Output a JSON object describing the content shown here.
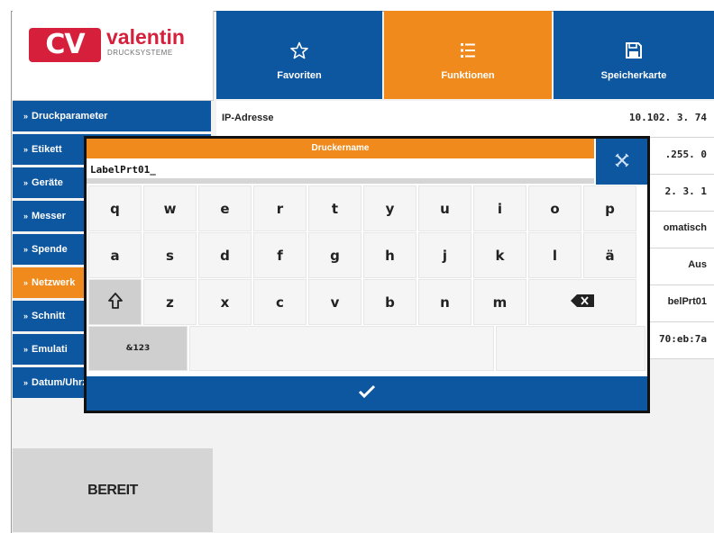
{
  "logo": {
    "mark": "CV",
    "name": "valentin",
    "sub": "DRUCKSYSTEME"
  },
  "tabs": [
    {
      "label": "Favoriten",
      "icon": "star-icon"
    },
    {
      "label": "Funktionen",
      "icon": "list-icon"
    },
    {
      "label": "Speicherkarte",
      "icon": "floppy-icon"
    }
  ],
  "sidebar": {
    "items": [
      {
        "label": "Druckparameter"
      },
      {
        "label": "Etikett"
      },
      {
        "label": "Geräte"
      },
      {
        "label": "Messer"
      },
      {
        "label": "Spende"
      },
      {
        "label": "Netzwerk"
      },
      {
        "label": "Schnitt"
      },
      {
        "label": "Emulati"
      },
      {
        "label": "Datum/Uhrzeit"
      }
    ]
  },
  "status": "BEREIT",
  "rows": [
    {
      "key": "IP-Adresse",
      "value": "10.102. 3. 74"
    },
    {
      "key": "",
      "value": ".255. 0"
    },
    {
      "key": "",
      "value": "2. 3. 1"
    },
    {
      "key": "",
      "value": "omatisch"
    },
    {
      "key": "",
      "value": "Aus"
    },
    {
      "key": "",
      "value": "belPrt01"
    },
    {
      "key": "",
      "value": "70:eb:7a"
    }
  ],
  "dialog": {
    "title": "Druckername",
    "input_value": "LabelPrt01_",
    "row1": [
      "q",
      "w",
      "e",
      "r",
      "t",
      "y",
      "u",
      "i",
      "o",
      "p"
    ],
    "row2": [
      "a",
      "s",
      "d",
      "f",
      "g",
      "h",
      "j",
      "k",
      "l",
      "ä"
    ],
    "row3": [
      "z",
      "x",
      "c",
      "v",
      "b",
      "n",
      "m"
    ],
    "shift_icon": "shift-icon",
    "backspace_icon": "backspace-icon",
    "mode_key": "&123",
    "confirm_icon": "checkmark-icon",
    "close_icon": "close-icon"
  },
  "colors": {
    "blue": "#0d56a0",
    "orange": "#f08a1c",
    "red": "#d61f3b"
  }
}
